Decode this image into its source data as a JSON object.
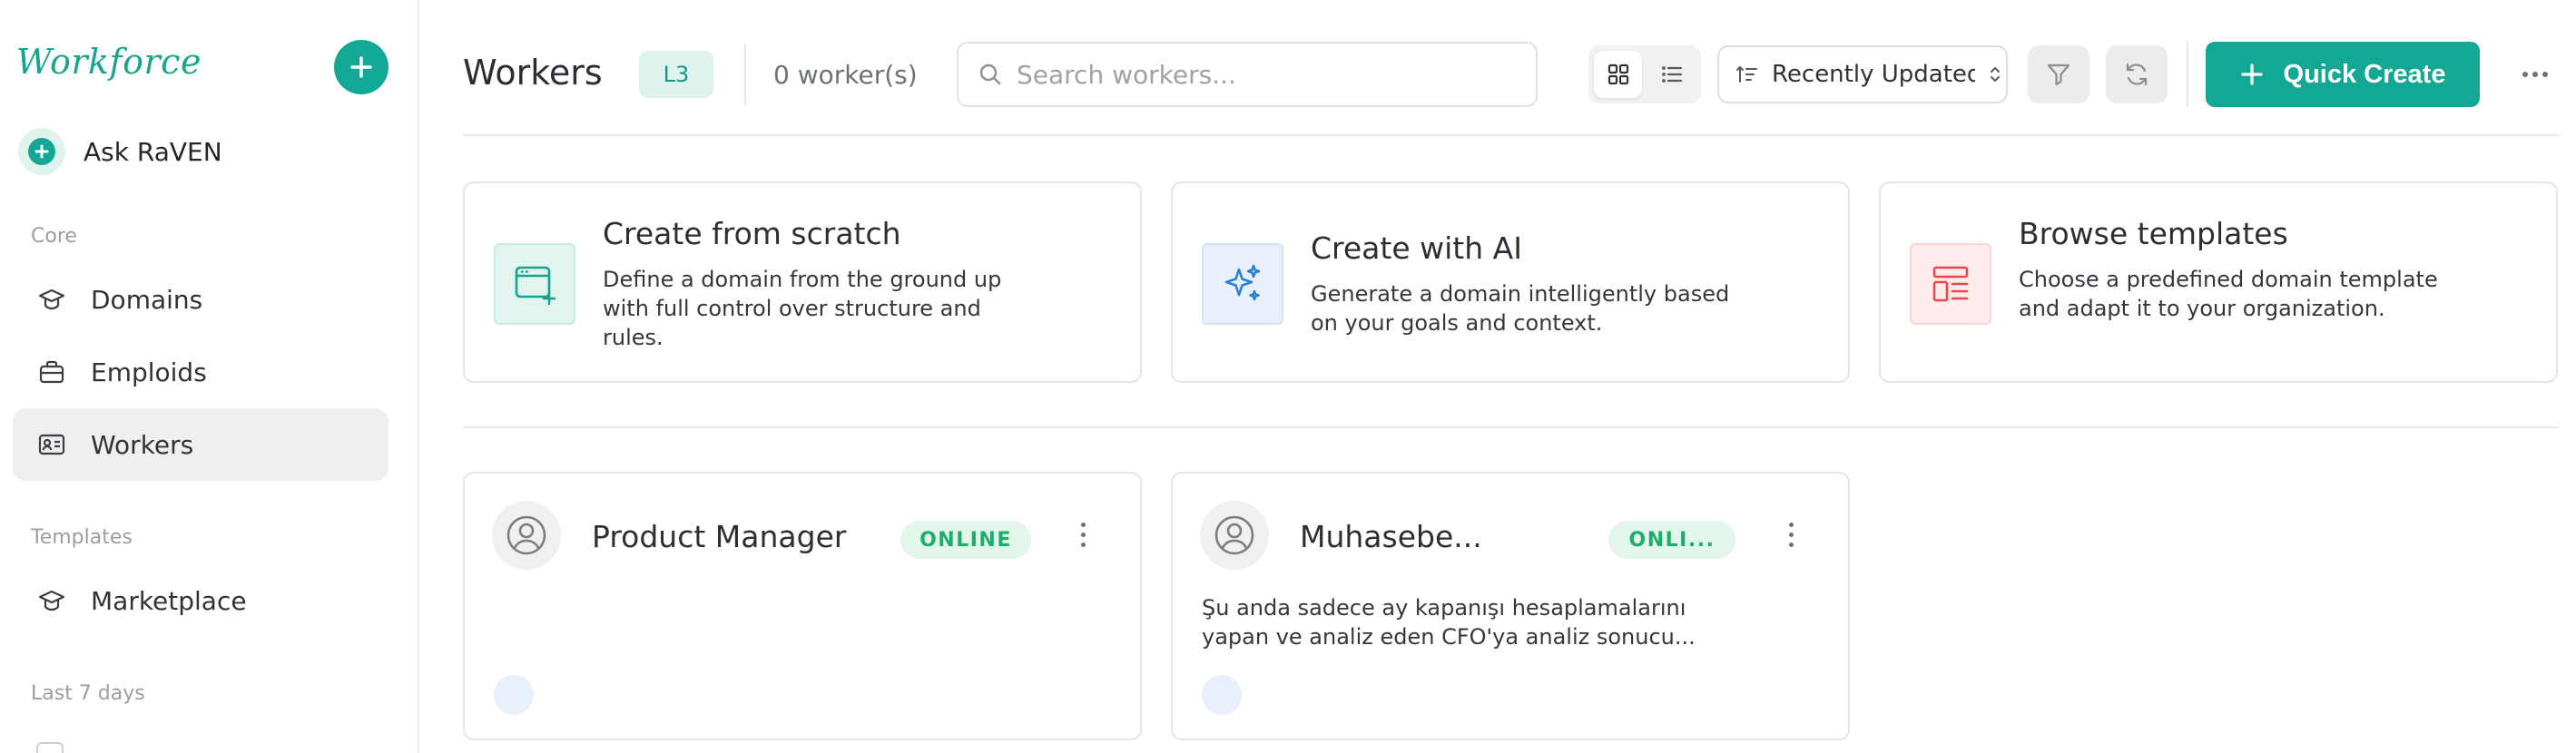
{
  "app": {
    "logo": "Workforce"
  },
  "sidebar": {
    "ask_label": "Ask RaVEN",
    "sections": {
      "core": "Core",
      "templates": "Templates",
      "recent": "Last 7 days"
    },
    "items": [
      {
        "label": "Domains",
        "icon": "cap-icon"
      },
      {
        "label": "Emploids",
        "icon": "briefcase-icon"
      },
      {
        "label": "Workers",
        "icon": "id-card-icon",
        "active": true
      },
      {
        "label": "Marketplace",
        "icon": "cap-icon"
      }
    ]
  },
  "header": {
    "title": "Workers",
    "level": "L3",
    "count": "0 worker(s)",
    "search_placeholder": "Search workers...",
    "sort_label": "Recently Updated",
    "quick_create_label": "Quick Create"
  },
  "create_cards": [
    {
      "title": "Create from scratch",
      "desc": "Define a domain from the ground up with full control over structure and rules.",
      "icon": "window-plus-icon"
    },
    {
      "title": "Create with AI",
      "desc": "Generate a domain intelligently based on your goals and context.",
      "icon": "sparkles-icon"
    },
    {
      "title": "Browse templates",
      "desc": "Choose a predefined domain template and adapt it to your organization.",
      "icon": "template-layout-icon"
    }
  ],
  "workers": [
    {
      "name": "Product Manager",
      "status": "ONLINE",
      "desc": ""
    },
    {
      "name": "Muhasebe...",
      "status": "ONLI...",
      "desc": "Şu anda sadece ay kapanışı hesaplamalarını yapan ve analiz eden CFO'ya analiz sonucu..."
    }
  ],
  "colors": {
    "accent": "#12a893",
    "online": "#1fae69",
    "danger": "#e5484d",
    "ai": "#2f7fd4"
  }
}
